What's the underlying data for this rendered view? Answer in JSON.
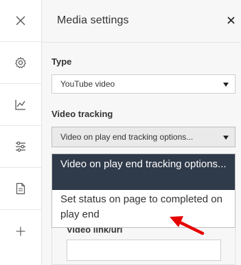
{
  "panel": {
    "title": "Media settings",
    "close_glyph": "×"
  },
  "rail": {
    "items": [
      "close-icon",
      "gear-icon",
      "chart-icon",
      "sliders-icon",
      "document-icon",
      "plus-icon"
    ]
  },
  "type_field": {
    "label": "Type",
    "value": "YouTube video"
  },
  "video_tracking": {
    "label": "Video tracking",
    "value": "Video on play end tracking options...",
    "options": [
      "Video on play end tracking options...",
      "Set status on page to completed on play end"
    ]
  },
  "video_link": {
    "label": "Video link/url",
    "value": ""
  },
  "colors": {
    "selected_option_bg": "#2f3a4a",
    "arrow": "#e60000"
  }
}
